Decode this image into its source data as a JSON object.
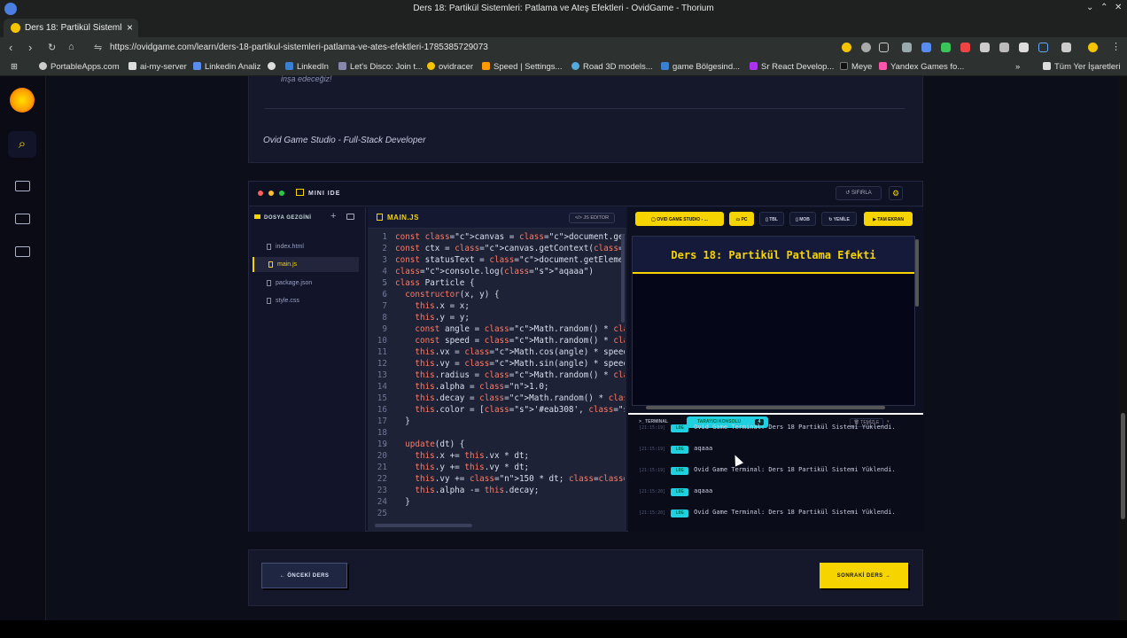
{
  "browser": {
    "window_title": "Ders 18: Partikül Sistemleri: Patlama ve Ateş Efektleri - OvidGame - Thorium",
    "tab_title": "Ders 18: Partikül Sistemleri",
    "url": "https://ovidgame.com/learn/ders-18-partikul-sistemleri-patlama-ve-ates-efektleri-1785385729073",
    "bookmarks": [
      "PortableApps.com",
      "ai-my-server",
      "Linkedin Analiz",
      "LinkedIn",
      "Let's Disco: Join t...",
      "ovidracer",
      "Speed | Settings...",
      "Road 3D models...",
      "game Bölgesind...",
      "Sr React Develop...",
      "Meye",
      "Yandex Games fo..."
    ],
    "bookmarks_folder": "Tüm Yer İşaretleri"
  },
  "article": {
    "trailing_text": "inşa edeceğiz!",
    "signature": "Ovid Game Studio - Full-Stack Developer"
  },
  "ide": {
    "title": "MINI IDE",
    "reset_label": "SIFIRLA",
    "explorer_title": "DOSYA GEZGİNİ",
    "files": [
      "index.html",
      "main.js",
      "package.json",
      "style.css"
    ],
    "active_file": "main.js",
    "editor_tab": "MAIN.JS",
    "editor_badge": "JS EDITOR",
    "code_lines": [
      "const canvas = document.getElementById('partic",
      "const ctx = canvas.getContext('2d');",
      "const statusText = document.getElementById('st",
      "console.log(\"aqaaa\")",
      "class Particle {",
      "  constructor(x, y) {",
      "    this.x = x;",
      "    this.y = y;",
      "    const angle = Math.random() * Math.PI * 2;",
      "    const speed = Math.random() * 250 + 50;",
      "    this.vx = Math.cos(angle) * speed;",
      "    this.vy = Math.sin(angle) * speed;",
      "    this.radius = Math.random() * 4 + 2;",
      "    this.alpha = 1.0;",
      "    this.decay = Math.random() * 0.02 + 0.015;",
      "    this.color = ['#eab308', '#ef4444', '#38bd",
      "  }",
      "",
      "  update(dt) {",
      "    this.x += this.vx * dt;",
      "    this.y += this.vy * dt;",
      "    this.vy += 150 * dt; // Hafif yerçekimi et",
      "    this.alpha -= this.decay;",
      "  }",
      ""
    ],
    "preview": {
      "studio_btn": "OVID GAME STUDIO - ...",
      "device_pc": "PC",
      "device_tbl": "TBL",
      "device_mob": "MOB",
      "refresh": "YENİLE",
      "fullscreen": "TAM EKRAN",
      "banner_title": "Ders 18: Partikül Patlama Efekti"
    },
    "console": {
      "tab_terminal": "TERMINAL",
      "tab_console": "TARAYICI KONSOLU",
      "count": "4",
      "clear": "TEMİZLE",
      "logs": [
        {
          "time": "[21:15:19]",
          "tag": "LOG",
          "text": "Ovid Game Terminal: Ders 18 Partikül Sistemi Yüklendi."
        },
        {
          "time": "[21:15:19]",
          "tag": "LOG",
          "text": "aqaaa"
        },
        {
          "time": "[21:15:19]",
          "tag": "LOG",
          "text": "Ovid Game Terminal: Ders 18 Partikül Sistemi Yüklendi."
        },
        {
          "time": "[21:15:20]",
          "tag": "LOG",
          "text": "aqaaa"
        },
        {
          "time": "[21:15:20]",
          "tag": "LOG",
          "text": "Ovid Game Terminal: Ders 18 Partikül Sistemi Yüklendi."
        }
      ]
    }
  },
  "nav": {
    "prev_label": "ÖNCEKİ DERS",
    "next_label": "SONRAKİ DERS"
  },
  "colors": {
    "accent": "#f5d400",
    "console_tag": "#1fd0e0",
    "page_bg": "#0c0e1a"
  }
}
